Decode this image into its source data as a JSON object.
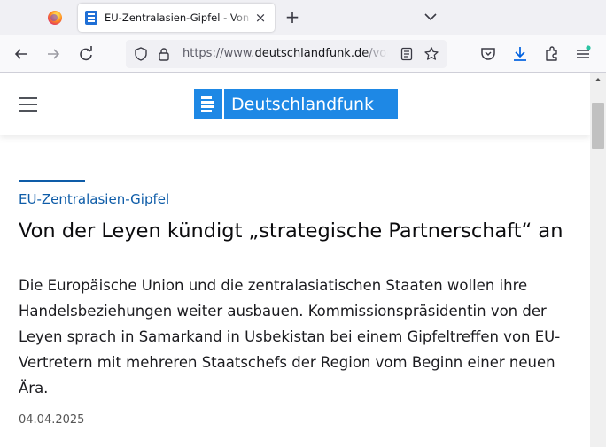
{
  "browser": {
    "active_tab_title": "EU-Zentralasien-Gipfel - Von der Leyen kündigt",
    "close_tab_glyph": "×",
    "new_tab_glyph": "+",
    "url_prefix": "https://www.",
    "url_host": "deutschlandfunk.de",
    "url_path": "/von-der-leyen"
  },
  "site": {
    "brand": "Deutschlandfunk",
    "brand_color": "#1e88e5"
  },
  "article": {
    "kicker": "EU-Zentralasien-Gipfel",
    "headline": "Von der Leyen kündigt „strategische Partnerschaft“ an",
    "teaser": "Die Europäische Union und die zentralasiatischen Staaten wollen ihre Handelsbeziehungen weiter ausbauen. Kommissionspräsidentin von der Leyen sprach in Samarkand in Usbekistan bei einem Gipfeltreffen von EU-Vertretern mit mehreren Staatschefs der Region vom Beginn einer neuen Ära.",
    "date": "04.04.2025"
  },
  "icons": {
    "tabbar": [
      "firefox-icon",
      "dlf-favicon",
      "close-icon",
      "plus-icon",
      "chevron-down-icon"
    ],
    "navbar": [
      "back-arrow-icon",
      "forward-arrow-icon",
      "reload-icon",
      "shield-icon",
      "lock-icon",
      "reader-view-icon",
      "star-icon",
      "pocket-icon",
      "download-icon",
      "extensions-icon",
      "menu-icon"
    ]
  }
}
